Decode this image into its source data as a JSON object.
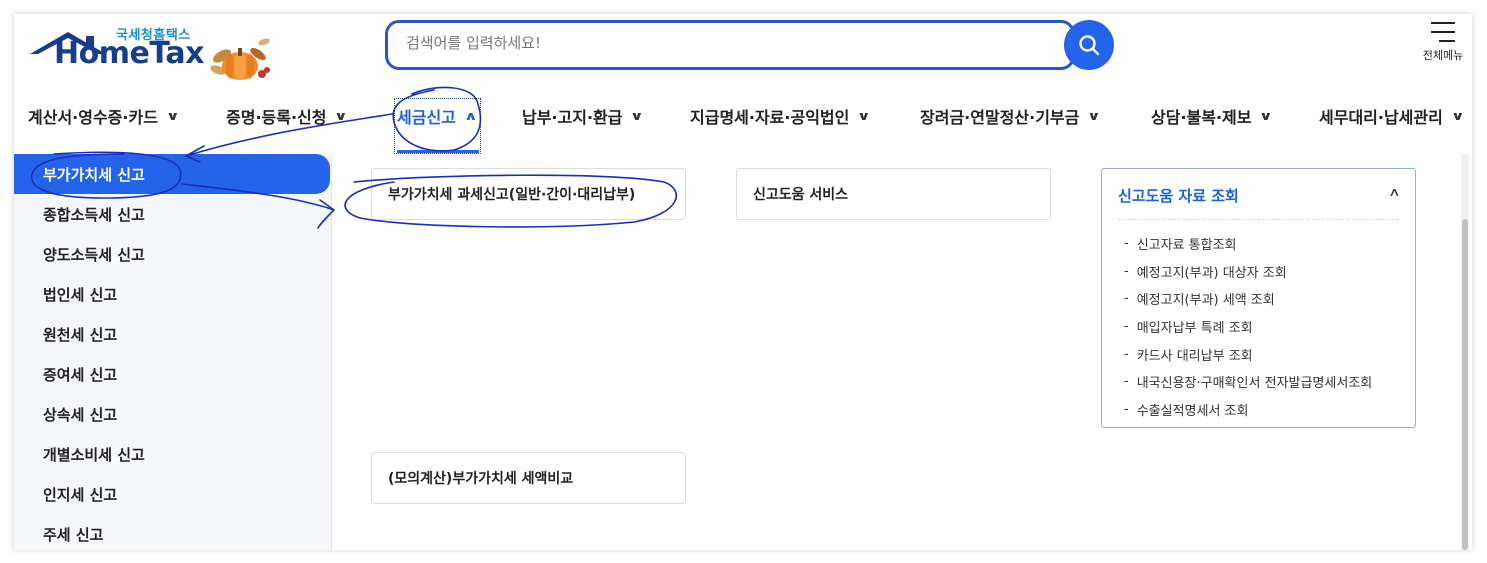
{
  "header": {
    "logo_kor": "국세청홈택스",
    "logo_eng": "HomeTax",
    "search_placeholder": "검색어를 입력하세요!",
    "all_menu_label": "전체메뉴"
  },
  "gnb": [
    {
      "label": "계산서·영수증·카드"
    },
    {
      "label": "증명·등록·신청"
    },
    {
      "label": "세금신고",
      "active": true
    },
    {
      "label": "납부·고지·환급"
    },
    {
      "label": "지급명세·자료·공익법인"
    },
    {
      "label": "장려금·연말정산·기부금"
    },
    {
      "label": "상담·불복·제보"
    },
    {
      "label": "세무대리·납세관리"
    }
  ],
  "lnb": [
    {
      "label": "부가가치세 신고",
      "active": true
    },
    {
      "label": "종합소득세 신고"
    },
    {
      "label": "양도소득세 신고"
    },
    {
      "label": "법인세 신고"
    },
    {
      "label": "원천세 신고"
    },
    {
      "label": "증여세 신고"
    },
    {
      "label": "상속세 신고"
    },
    {
      "label": "개별소비세 신고"
    },
    {
      "label": "인지세 신고"
    },
    {
      "label": "주세 신고"
    }
  ],
  "content": {
    "card_vat": "부가가치세 과세신고(일반·간이·대리납부)",
    "card_help": "신고도움 서비스",
    "card_mock": "(모의계산)부가가치세 세액비교",
    "panel_title": "신고도움 자료 조회",
    "panel_items": [
      "신고자료 통합조회",
      "예정고지(부과) 대상자 조회",
      "예정고지(부과) 세액 조회",
      "매입자납부 특례 조회",
      "카드사 대리납부 조회",
      "내국신용장·구매확인서 전자발급명세서조회",
      "수출실적명세서 조회"
    ]
  },
  "colors": {
    "accent": "#2563eb",
    "annotation_ink": "#1a2fb8"
  }
}
